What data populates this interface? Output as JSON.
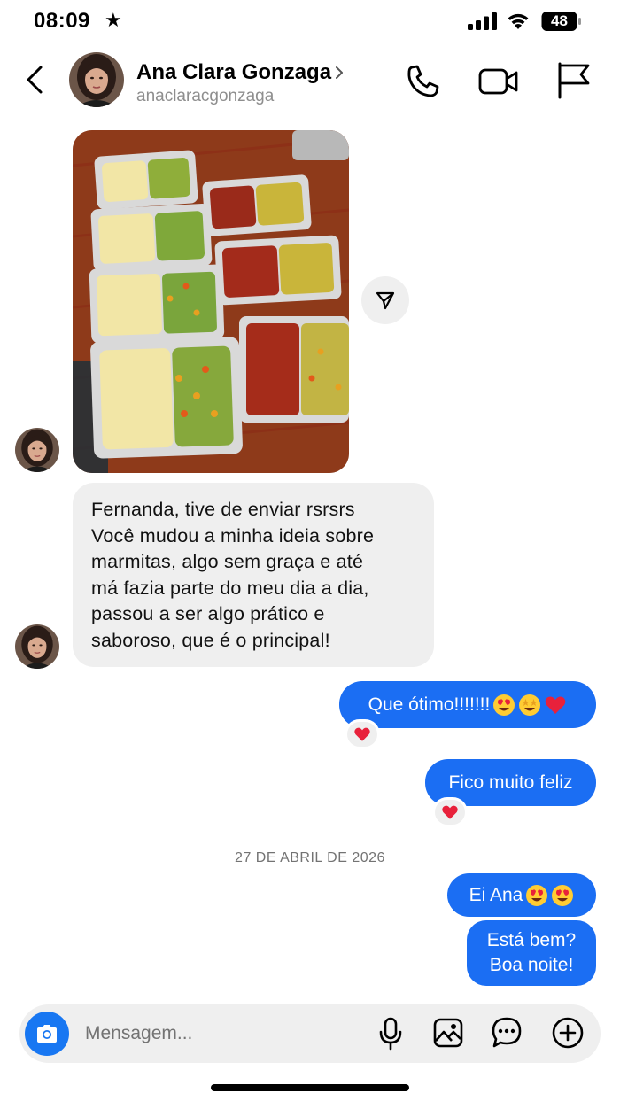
{
  "status_bar": {
    "time": "08:09",
    "focus_icon": "star-icon",
    "battery_level": "48",
    "icons": [
      "signal-icon",
      "wifi-icon",
      "battery-icon"
    ]
  },
  "header": {
    "contact_name": "Ana Clara Gonzaga",
    "contact_handle": "anaclaracgonzaga",
    "icons": [
      "back-icon",
      "chevron-right-icon",
      "phone-icon",
      "video-camera-icon",
      "flag-icon"
    ]
  },
  "messages": {
    "photo": {
      "description_icon": "food-photo",
      "share_icon": "send-icon"
    },
    "incoming_text": {
      "lines": [
        "Fernanda, tive de enviar rsrsrs",
        "Você mudou a minha ideia sobre",
        "marmitas, algo sem graça e até",
        "má fazia parte do meu dia a dia,",
        "passou a ser algo prático e",
        "saboroso, que é o principal!"
      ]
    },
    "outgoing": [
      {
        "text": "Que ótimo!!!!!!! ",
        "emojis": [
          "heart-eyes-emoji",
          "star-struck-emoji",
          "red-heart-emoji"
        ],
        "reaction": "red-heart-emoji"
      },
      {
        "text": "Fico muito feliz",
        "emojis": [],
        "reaction": "red-heart-emoji"
      }
    ],
    "date_separator": "27 DE ABRIL DE 2026",
    "outgoing_after_date": [
      {
        "text": "Ei Ana ",
        "emojis": [
          "heart-eyes-emoji",
          "heart-eyes-emoji"
        ]
      },
      {
        "lines": [
          "Está bem?",
          "Boa noite!"
        ]
      }
    ]
  },
  "composer": {
    "placeholder": "Mensagem...",
    "icons": [
      "camera-icon",
      "microphone-icon",
      "image-icon",
      "sticker-icon",
      "plus-circle-icon"
    ]
  },
  "colors": {
    "outgoing_bubble": "#1b6ef3",
    "incoming_bubble": "#efefef",
    "camera_button": "#1877f2",
    "reaction_heart": "#e8213b"
  }
}
